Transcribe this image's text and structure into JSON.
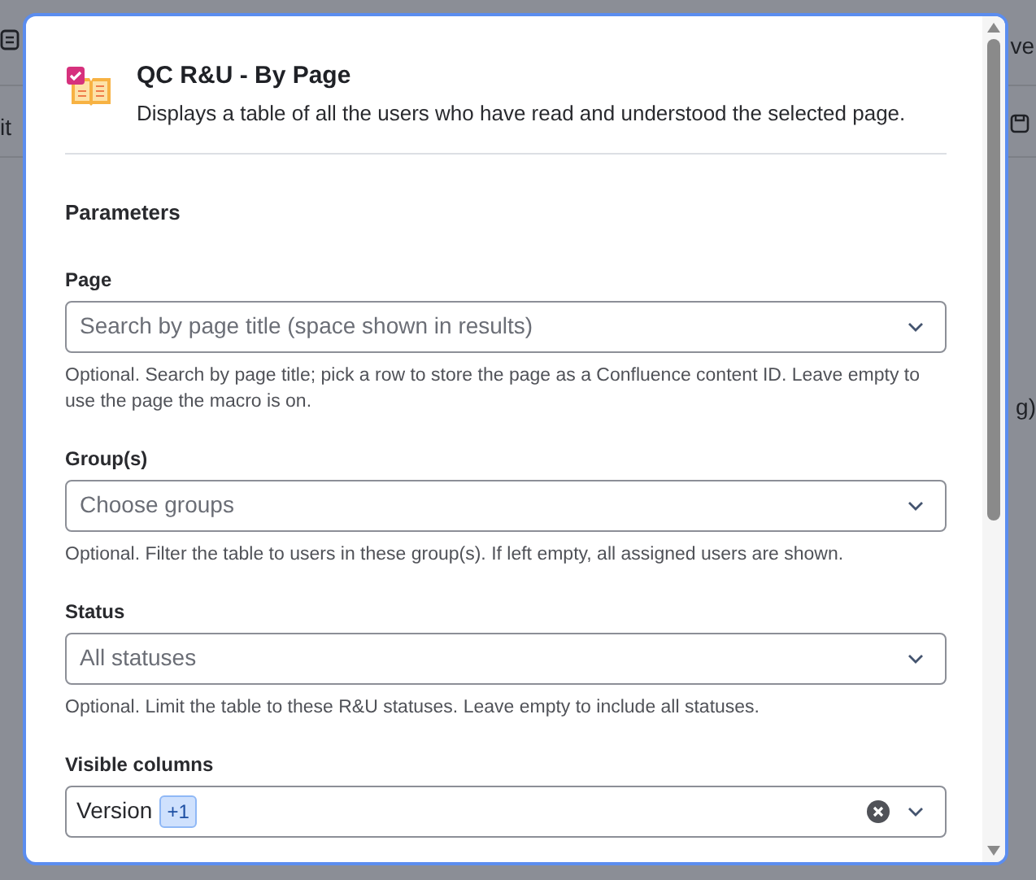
{
  "background": {
    "fragments": [
      "ve",
      "it",
      "g)"
    ]
  },
  "dialog": {
    "title": "QC R&U - By Page",
    "description": "Displays a table of all the users who have read and understood the selected page.",
    "section_title": "Parameters",
    "fields": [
      {
        "label": "Page",
        "kind": "placeholder",
        "placeholder": "Search by page title (space shown in results)",
        "help": "Optional. Search by page title; pick a row to store the page as a Confluence content ID. Leave empty to use the page the macro is on."
      },
      {
        "label": "Group(s)",
        "kind": "placeholder",
        "placeholder": "Choose groups",
        "help": "Optional. Filter the table to users in these group(s). If left empty, all assigned users are shown."
      },
      {
        "label": "Status",
        "kind": "placeholder",
        "placeholder": "All statuses",
        "help": "Optional. Limit the table to these R&U statuses. Leave empty to include all statuses."
      },
      {
        "label": "Visible columns",
        "kind": "multi",
        "value": "Version",
        "more": "+1"
      }
    ]
  }
}
